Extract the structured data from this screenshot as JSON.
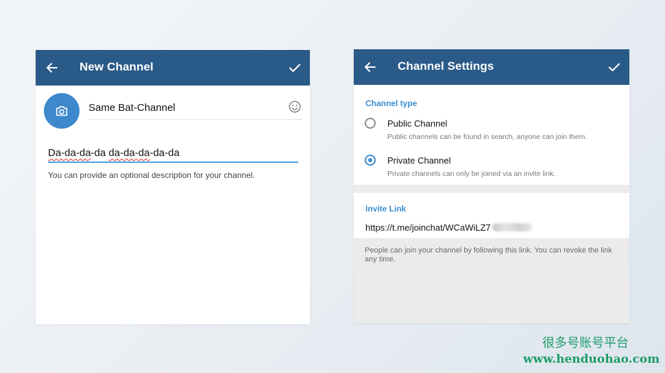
{
  "new_channel": {
    "title": "New Channel",
    "channel_name": "Same Bat-Channel",
    "description_parts": [
      "Da-da-da",
      "-da ",
      "da-da-da",
      "-da-da"
    ],
    "description_hint": "You can provide an optional description for your channel."
  },
  "channel_settings": {
    "title": "Channel Settings",
    "type_header": "Channel type",
    "options": [
      {
        "label": "Public Channel",
        "sub": "Public channels can be found in search, anyone can join them.",
        "selected": false
      },
      {
        "label": "Private Channel",
        "sub": "Private channels can only be joined via an invite link.",
        "selected": true
      }
    ],
    "link_header": "Invite Link",
    "invite_link": "https://t.me/joinchat/WCaWiLZ7",
    "link_hint": "People can join your channel by following this link. You can revoke the link any time."
  },
  "watermark": {
    "line1": "很多号账号平台",
    "line2": "www.henduohao.com"
  },
  "colors": {
    "appbar": "#2a5a88",
    "accent": "#3a8cd0",
    "avatar": "#3d89cc",
    "watermark": "#1e9c6a"
  },
  "icons": [
    "back-arrow-icon",
    "check-icon",
    "camera-icon",
    "emoji-icon"
  ]
}
